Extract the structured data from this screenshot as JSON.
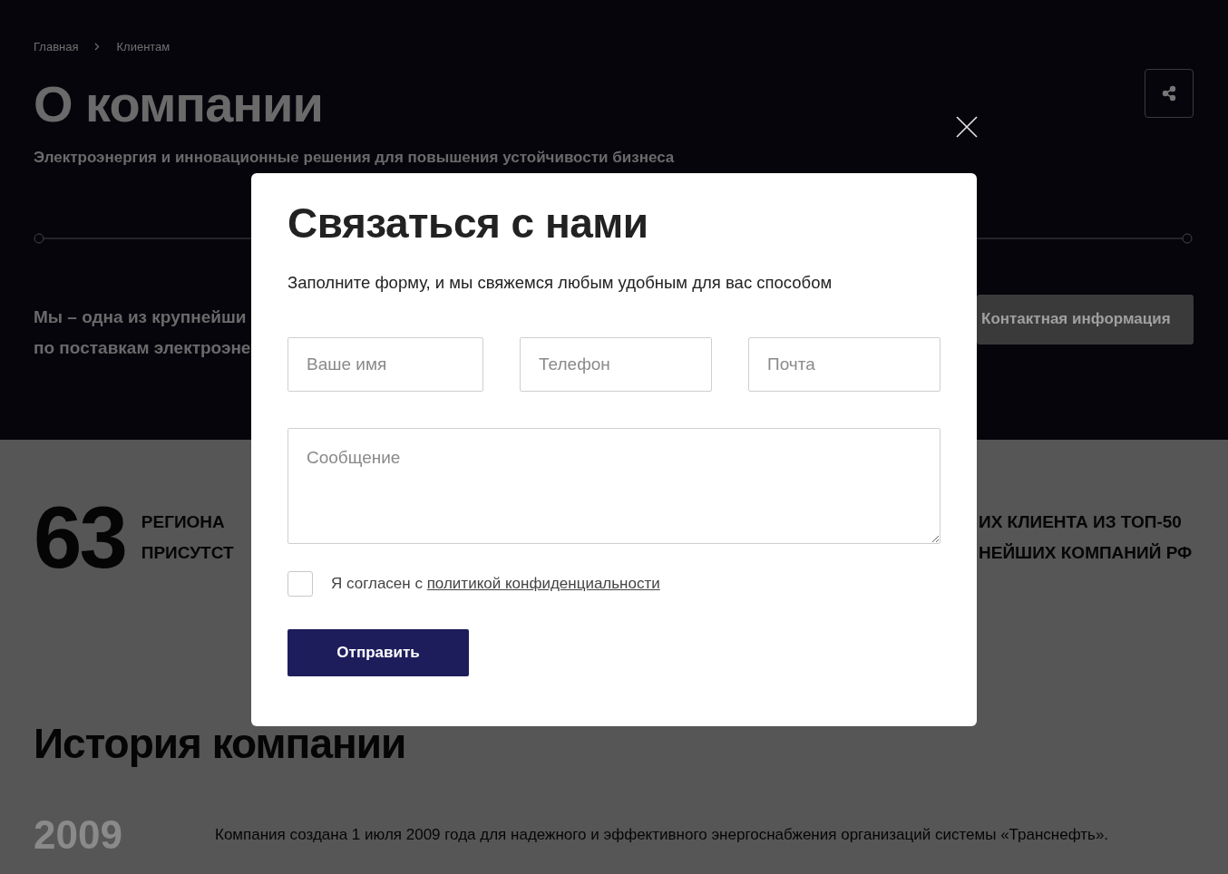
{
  "breadcrumbs": [
    {
      "label": "Главная"
    },
    {
      "label": "Клиентам"
    }
  ],
  "page_title": "О компании",
  "subtitle": "Электроэнергия и инновационные решения для повышения устойчивости бизнеса",
  "intro_lines": [
    "Мы – одна из крупнейши",
    "по поставкам электроэне"
  ],
  "contact_button": "Контактная информация",
  "stats": [
    {
      "number": "63",
      "lines": [
        "РЕГИОНА",
        "ПРИСУТСТ"
      ]
    },
    {
      "lines": [
        "ИХ КЛИЕНТА ИЗ ТОП-50",
        "НЕЙШИХ КОМПАНИЙ РФ"
      ]
    }
  ],
  "history": {
    "title": "История компании",
    "items": [
      {
        "year": "2009",
        "text": "Компания создана 1 июля 2009 года для надежного и эффективного энергоснабжения организаций системы «Транснефть»."
      }
    ]
  },
  "modal": {
    "title": "Связаться с нами",
    "lead": "Заполните форму, и мы свяжемся любым удобным для вас способом",
    "fields": [
      {
        "placeholder": "Ваше имя"
      },
      {
        "placeholder": "Телефон"
      },
      {
        "placeholder": "Почта"
      }
    ],
    "message": {
      "placeholder": "Сообщение"
    },
    "consent": {
      "checked": false,
      "text": "Я согласен с",
      "link": "политикой конфиденциальности"
    },
    "submit": "Отправить"
  }
}
